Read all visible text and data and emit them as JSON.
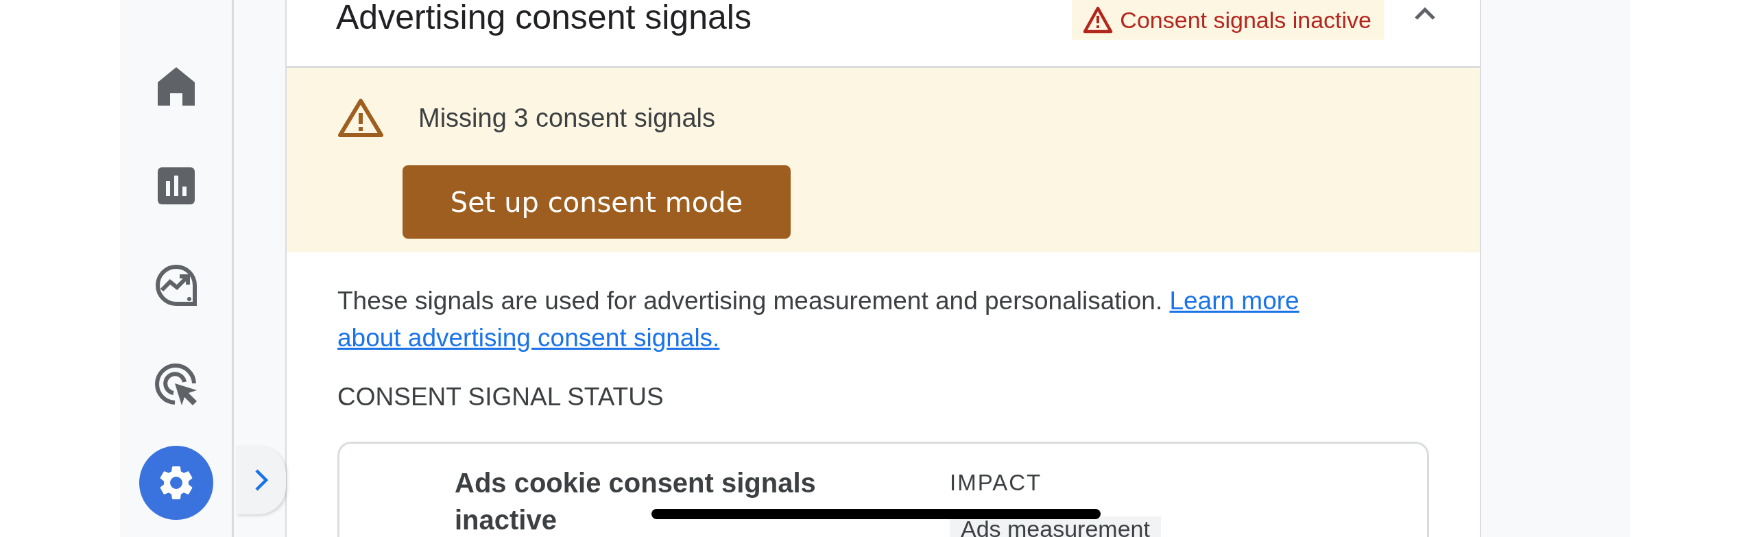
{
  "nav": {
    "items": [
      {
        "kind": "home",
        "selected": false
      },
      {
        "kind": "reports",
        "selected": false
      },
      {
        "kind": "explore",
        "selected": false
      },
      {
        "kind": "advertising",
        "selected": false
      },
      {
        "kind": "admin",
        "selected": true
      }
    ]
  },
  "section": {
    "title": "Advertising consent signals",
    "status": "Consent signals inactive",
    "expanded": true
  },
  "banner": {
    "message": "Missing 3 consent signals",
    "button": "Set up consent mode"
  },
  "description": {
    "text": "These signals are used for advertising measurement and personalisation.",
    "link_lines": [
      "Learn more",
      "about advertising consent signals."
    ]
  },
  "status_heading": "CONSENT SIGNAL STATUS",
  "status_card": {
    "title": "Ads cookie consent signals inactive",
    "impact_label": "IMPACT",
    "impacts": [
      "Ads measurement"
    ]
  }
}
